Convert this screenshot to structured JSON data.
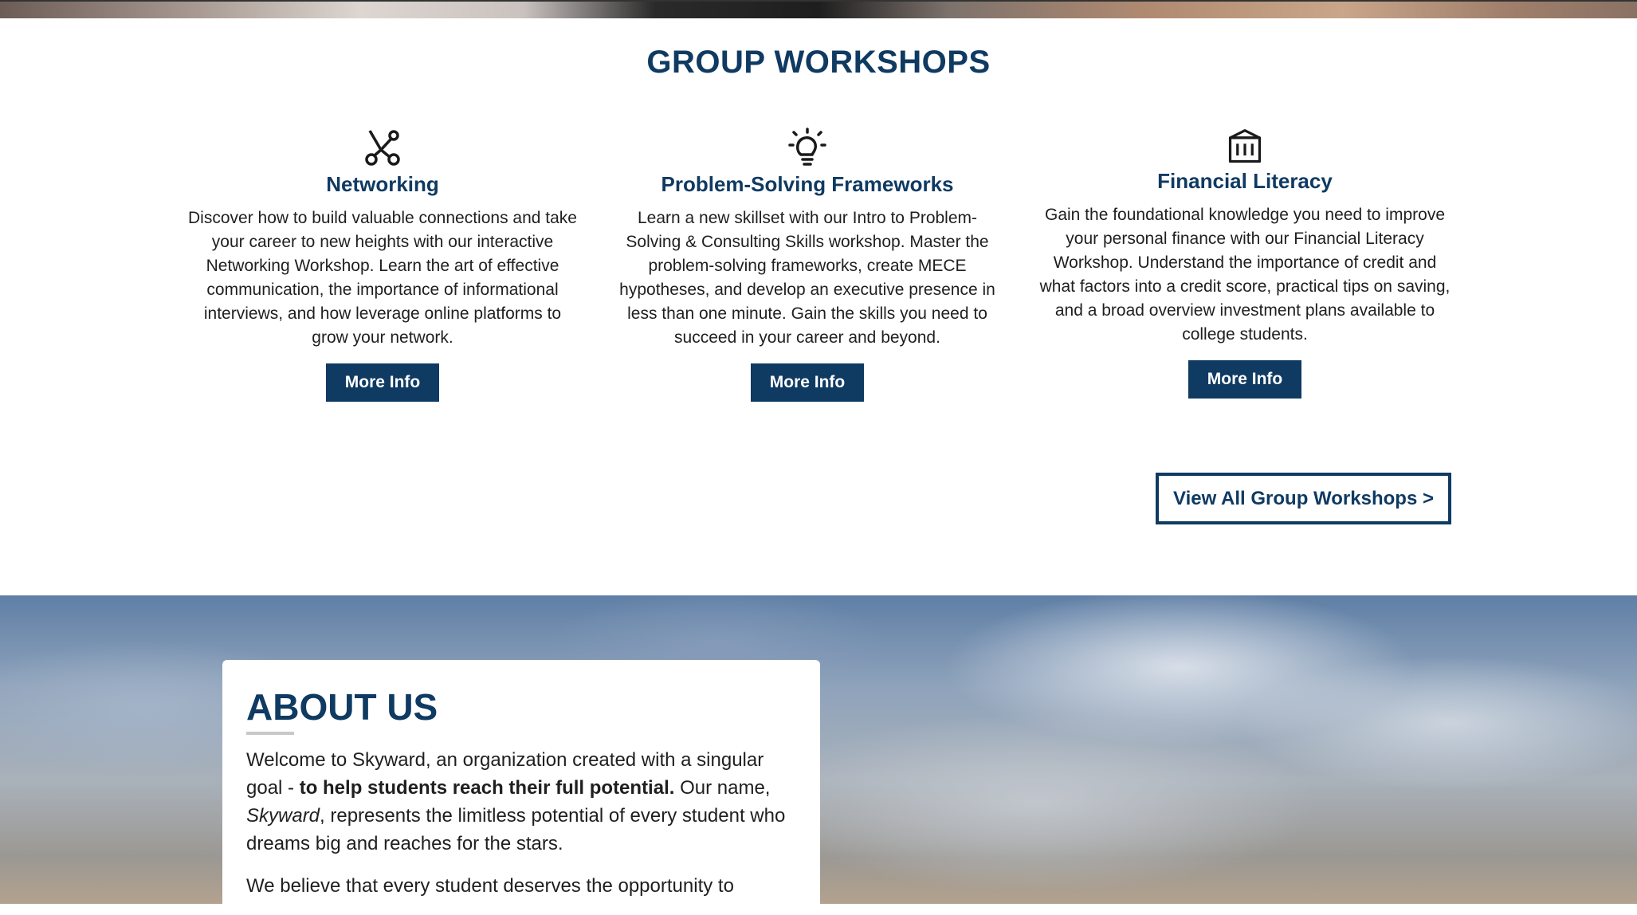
{
  "workshops": {
    "title": "GROUP WORKSHOPS",
    "cards": [
      {
        "icon": "network-icon",
        "title": "Networking",
        "description": "Discover how to build valuable connections and take your career to new heights with our interactive Networking Workshop. Learn the art of effective communication, the importance of informational interviews, and how leverage online platforms to grow your network.",
        "button": "More Info"
      },
      {
        "icon": "lightbulb-icon",
        "title": "Problem-Solving Frameworks",
        "description": "Learn a new skillset with our Intro to Problem-Solving & Consulting Skills workshop. Master the problem-solving frameworks, create MECE hypotheses, and develop an executive presence in less than one minute. Gain the skills you need to succeed in your career and beyond.",
        "button": "More Info"
      },
      {
        "icon": "bank-icon",
        "title": "Financial Literacy",
        "description": "Gain the foundational knowledge you need to improve your personal finance with our Financial Literacy Workshop. Understand the importance of credit and what factors into a credit score, practical tips on saving, and a broad overview investment plans available to college students.",
        "button": "More Info"
      }
    ],
    "view_all": "View All Group Workshops >"
  },
  "about": {
    "title": "ABOUT US",
    "p1_start": "Welcome to Skyward, an organization created with a singular goal - ",
    "p1_bold": "to help students reach their full potential.",
    "p1_mid": " Our name, ",
    "p1_italic": "Skyward",
    "p1_end": ", represents the limitless potential of every student who dreams big and reaches for the stars.",
    "p2": "We believe that every student deserves the opportunity to"
  },
  "colors": {
    "brand_navy": "#0f3a62",
    "white": "#ffffff"
  }
}
